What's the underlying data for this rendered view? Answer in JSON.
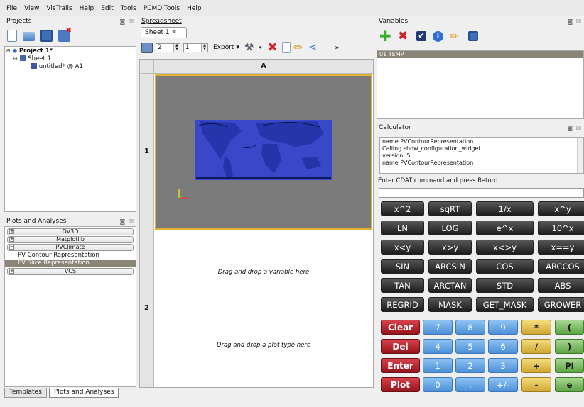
{
  "menubar": {
    "items": [
      "File",
      "View",
      "VisTrails",
      "Help",
      "Edit",
      "Tools",
      "PCMDITools",
      "Help"
    ]
  },
  "projects": {
    "title": "Projects",
    "dock_buttons": "◙ ☒",
    "tree": {
      "project": "Project 1*",
      "sheet": "Sheet 1",
      "cell": "untitled* @ A1"
    }
  },
  "plots": {
    "title": "Plots and Analyses",
    "dock_buttons": "◙ ☒",
    "categories": {
      "dv3d": "DV3D",
      "matplotlib": "Matplotlib",
      "pvclimate": "PVClimate",
      "vcs": "VCS"
    },
    "pv_items": [
      "PV Contour Representation",
      "PV Slice Representation"
    ],
    "bottom_tabs": [
      "Templates",
      "Plots and Analyses"
    ]
  },
  "spreadsheet": {
    "title": "Spreadsheet",
    "tab": "Sheet 1",
    "rows_value": "2",
    "cols_value": "1",
    "export_label": "Export",
    "more": "»",
    "col_header": "A",
    "row_headers": [
      "1",
      "2"
    ],
    "cell2_top_text": "Drag and drop a variable here",
    "cell2_bottom_text": "Drag and drop a plot type here"
  },
  "variables": {
    "title": "Variables",
    "dock_buttons": "◙ ☒",
    "items": [
      "01 TEMP"
    ]
  },
  "calculator": {
    "title": "Calculator",
    "dock_buttons": "◙ ☒",
    "log_lines": [
      "name  PVContourRepresentation",
      "Calling show_configuration_widget",
      "version:  5",
      "name  PVContourRepresentation"
    ],
    "prompt_label": "Enter CDAT command and press Return",
    "input_value": "",
    "func_buttons": [
      "x^2",
      "sqRT",
      "1/x",
      "x^y",
      "LN",
      "LOG",
      "e^x",
      "10^x",
      "x<y",
      "x>y",
      "x<>y",
      "x==y",
      "SIN",
      "ARCSIN",
      "COS",
      "ARCCOS",
      "TAN",
      "ARCTAN",
      "STD",
      "ABS",
      "REGRID",
      "MASK",
      "GET_MASK",
      "GROWER"
    ],
    "action_buttons": [
      "Clear",
      "Del",
      "Enter",
      "Plot"
    ],
    "digit_buttons": [
      "7",
      "8",
      "9",
      "4",
      "5",
      "6",
      "1",
      "2",
      "3",
      "0",
      ".",
      "+/-"
    ],
    "op_buttons": [
      "*",
      "/",
      "+",
      "-"
    ],
    "extra_buttons": [
      "(",
      ")",
      "PI",
      "e"
    ]
  },
  "colors": {
    "accent_gold": "#e0b030",
    "map_blue": "#3948c8",
    "cell_gray": "#7b7b7b",
    "selection_gray": "#8a8578"
  },
  "icons": [
    "new-project-icon",
    "open-project-icon",
    "save-project-icon",
    "close-project-icon",
    "add-variable-icon",
    "delete-variable-icon",
    "checkbox-icon",
    "info-icon",
    "edit-pencil-icon",
    "save-icon",
    "tools-icon",
    "delete-x-icon",
    "document-icon",
    "pencil-icon",
    "share-graph-icon"
  ]
}
